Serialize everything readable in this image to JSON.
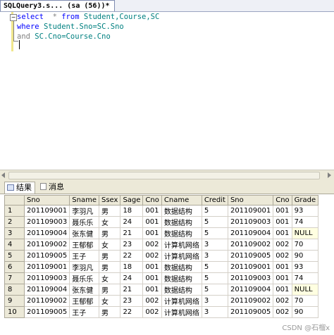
{
  "document_tab": {
    "title": "SQLQuery3.s... (sa (56))*"
  },
  "editor": {
    "lines": [
      {
        "parts": [
          {
            "t": "select  ",
            "c": "kw"
          },
          {
            "t": "* ",
            "c": "gr"
          },
          {
            "t": "from ",
            "c": "kw"
          },
          {
            "t": "Student,Course,SC",
            "c": "id"
          }
        ]
      },
      {
        "parts": [
          {
            "t": "where ",
            "c": "kw"
          },
          {
            "t": "Student.Sno=SC.Sno",
            "c": "id"
          }
        ]
      },
      {
        "parts": [
          {
            "t": "and ",
            "c": "gr"
          },
          {
            "t": "SC.Cno=Course.Cno",
            "c": "id"
          }
        ]
      }
    ]
  },
  "results_tabs": {
    "results": "结果",
    "messages": "消息"
  },
  "grid": {
    "columns": [
      "Sno",
      "Sname",
      "Ssex",
      "Sage",
      "Cno",
      "Cname",
      "Credit",
      "Sno",
      "Cno",
      "Grade"
    ],
    "rows": [
      [
        "1",
        "201109001",
        "李羽凡",
        "男",
        "18",
        "001",
        "数据结构",
        "5",
        "201109001",
        "001",
        "93"
      ],
      [
        "2",
        "201109003",
        "聂乐乐",
        "女",
        "24",
        "001",
        "数据结构",
        "5",
        "201109003",
        "001",
        "74"
      ],
      [
        "3",
        "201109004",
        "张东健",
        "男",
        "21",
        "001",
        "数据结构",
        "5",
        "201109004",
        "001",
        "NULL"
      ],
      [
        "4",
        "201109002",
        "王郁郁",
        "女",
        "23",
        "002",
        "计算机网络",
        "3",
        "201109002",
        "002",
        "70"
      ],
      [
        "5",
        "201109005",
        "王子",
        "男",
        "22",
        "002",
        "计算机网络",
        "3",
        "201109005",
        "002",
        "90"
      ],
      [
        "6",
        "201109001",
        "李羽凡",
        "男",
        "18",
        "001",
        "数据结构",
        "5",
        "201109001",
        "001",
        "93"
      ],
      [
        "7",
        "201109003",
        "聂乐乐",
        "女",
        "24",
        "001",
        "数据结构",
        "5",
        "201109003",
        "001",
        "74"
      ],
      [
        "8",
        "201109004",
        "张东健",
        "男",
        "21",
        "001",
        "数据结构",
        "5",
        "201109004",
        "001",
        "NULL"
      ],
      [
        "9",
        "201109002",
        "王郁郁",
        "女",
        "23",
        "002",
        "计算机网络",
        "3",
        "201109002",
        "002",
        "70"
      ],
      [
        "10",
        "201109005",
        "王子",
        "男",
        "22",
        "002",
        "计算机网络",
        "3",
        "201109005",
        "002",
        "90"
      ]
    ]
  },
  "watermark": "CSDN @石榴x"
}
